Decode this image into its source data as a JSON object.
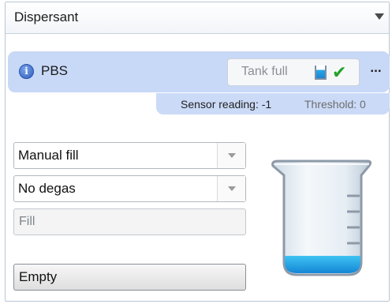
{
  "header": {
    "title": "Dispersant"
  },
  "dispersant": {
    "name": "PBS",
    "tank_status": "Tank full",
    "more_label": "...",
    "sensor_reading": "Sensor reading: -1",
    "threshold": "Threshold: 0"
  },
  "controls": {
    "fill_mode": "Manual fill",
    "degas_mode": "No degas",
    "fill_button": "Fill",
    "empty_button": "Empty"
  },
  "icons": {
    "info": "info-icon",
    "tank": "tank-level-icon",
    "check": "checkmark-icon",
    "beaker": "beaker-icon"
  },
  "colors": {
    "card": "#c8d8f7",
    "liquid": "#2aa7e8",
    "check": "#23a227"
  }
}
